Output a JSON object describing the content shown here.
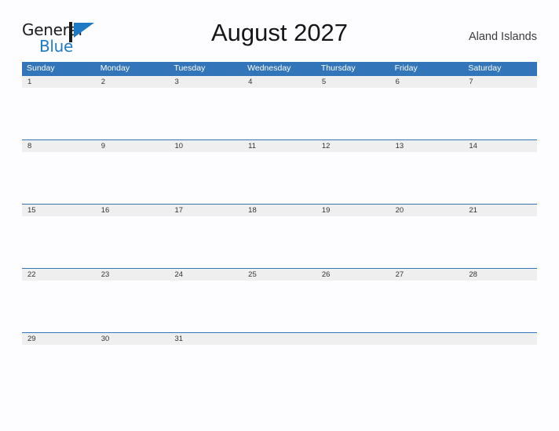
{
  "brand": {
    "name_part1": "General",
    "name_part2": "Blue",
    "flag_icon": "blue-flag-icon",
    "accent_color": "#1f7ac4"
  },
  "header": {
    "title": "August 2027",
    "region": "Aland Islands"
  },
  "colors": {
    "header_blue": "#3275b8",
    "band_gray": "#efefef",
    "page_background": "#fdfdff",
    "title_text": "#161616"
  },
  "calendar": {
    "month": "August",
    "year": "2027",
    "weekdays": [
      "Sunday",
      "Monday",
      "Tuesday",
      "Wednesday",
      "Thursday",
      "Friday",
      "Saturday"
    ],
    "weeks": [
      [
        "1",
        "2",
        "3",
        "4",
        "5",
        "6",
        "7"
      ],
      [
        "8",
        "9",
        "10",
        "11",
        "12",
        "13",
        "14"
      ],
      [
        "15",
        "16",
        "17",
        "18",
        "19",
        "20",
        "21"
      ],
      [
        "22",
        "23",
        "24",
        "25",
        "26",
        "27",
        "28"
      ],
      [
        "29",
        "30",
        "31",
        "",
        "",
        "",
        ""
      ]
    ]
  }
}
